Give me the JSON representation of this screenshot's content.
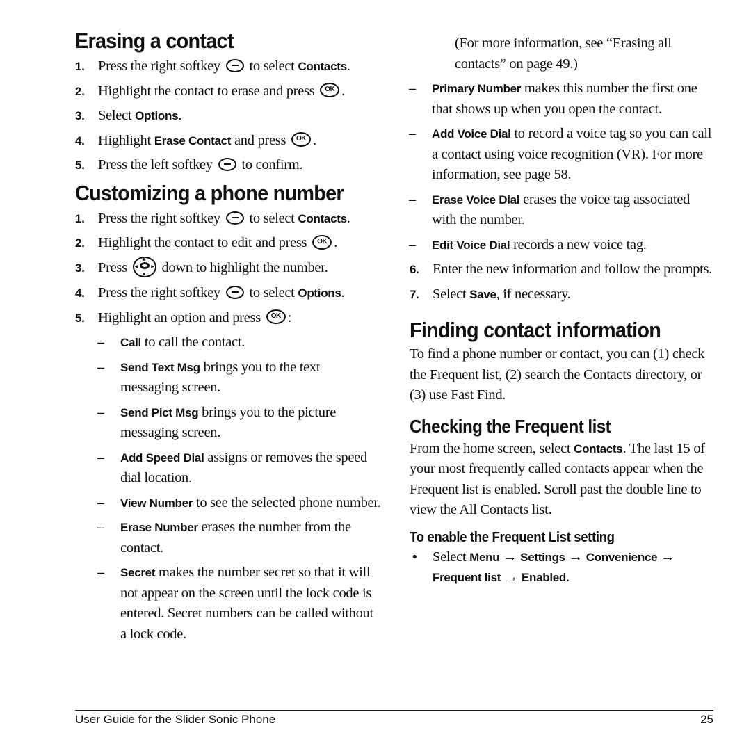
{
  "left": {
    "erasing": {
      "heading": "Erasing a contact",
      "steps": [
        {
          "num": "1.",
          "pre": "Press the right softkey",
          "icon": "right-softkey-icon",
          "post": " to select ",
          "bold": "Contacts",
          "end": "."
        },
        {
          "num": "2.",
          "pre": "Highlight the contact to erase and press",
          "icon": "ok-key-icon",
          "post": ".",
          "bold": "",
          "end": ""
        },
        {
          "num": "3.",
          "pre": "Select ",
          "bold": "Options",
          "end": "."
        },
        {
          "num": "4.",
          "pre": "Highlight ",
          "bold": "Erase Contact",
          "mid": " and press",
          "icon": "ok-key-icon",
          "end": "."
        },
        {
          "num": "5.",
          "pre": "Press the left softkey",
          "icon": "left-softkey-icon",
          "post": " to confirm."
        }
      ]
    },
    "customizing": {
      "heading": "Customizing a phone number",
      "steps": [
        {
          "num": "1.",
          "pre": "Press the right softkey",
          "icon": "right-softkey-icon",
          "post": " to select ",
          "bold": "Contacts",
          "end": "."
        },
        {
          "num": "2.",
          "pre": "Highlight the contact to edit and press",
          "icon": "ok-key-icon",
          "post": "."
        },
        {
          "num": "3.",
          "pre": "Press",
          "icon": "navigation-key-icon",
          "post": "down to highlight the number."
        },
        {
          "num": "4.",
          "pre": "Press the right softkey",
          "icon": "right-softkey-icon",
          "post": " to select ",
          "bold": "Options",
          "end": "."
        },
        {
          "num": "5.",
          "pre": "Highlight an option and press",
          "icon": "ok-key-icon",
          "post": ":"
        }
      ],
      "options": [
        {
          "bold": "Call",
          "text": " to call the contact."
        },
        {
          "bold": "Send Text Msg",
          "text": " brings you to the text messaging screen."
        },
        {
          "bold": "Send Pict Msg",
          "text": " brings you to the picture messaging screen."
        },
        {
          "bold": "Add Speed Dial",
          "text": " assigns or removes the speed dial location."
        },
        {
          "bold": "View Number",
          "text": " to see the selected phone number."
        },
        {
          "bold": "Erase Number",
          "text": " erases the number from the contact."
        },
        {
          "bold": "Secret",
          "text": " makes the number secret so that it will not appear on the screen until the lock code is entered. Secret numbers can be called without a lock code."
        }
      ]
    }
  },
  "right": {
    "continued_note": "(For more information, see “Erasing all contacts” on page 49.)",
    "options": [
      {
        "bold": "Primary Number",
        "text": " makes this number the first one that shows up when you open the contact."
      },
      {
        "bold": "Add Voice Dial",
        "text": " to record a voice tag so you can call a contact using voice recognition (VR). For more information, see page 58."
      },
      {
        "bold": "Erase Voice Dial",
        "text": " erases the voice tag associated with the number."
      },
      {
        "bold": "Edit Voice Dial",
        "text": " records a new voice tag."
      }
    ],
    "steps": [
      {
        "num": "6.",
        "text": "Enter the new information and follow the prompts."
      },
      {
        "num": "7.",
        "pre": "Select ",
        "bold": "Save",
        "end": ", if necessary."
      }
    ],
    "finding": {
      "heading": "Finding contact information",
      "body": "To find a phone number or contact, you can (1) check the Frequent list, (2) search the Contacts directory, or (3) use Fast Find."
    },
    "frequent": {
      "heading": "Checking the Frequent list",
      "body_pre": "From the home screen, select ",
      "body_bold": "Contacts",
      "body_post": ". The last 15 of your most frequently called contacts appear when the Frequent list is enabled. Scroll past the double line to view the All Contacts list.",
      "procedure_heading": "To enable the Frequent List setting",
      "bullet_pre": "Select ",
      "path": [
        "Menu",
        "Settings",
        "Convenience",
        "Frequent list",
        "Enabled"
      ],
      "arrow": "→",
      "bullet_end": "."
    }
  },
  "footer": {
    "title": "User Guide for the Slider Sonic Phone",
    "page_number": "25"
  }
}
